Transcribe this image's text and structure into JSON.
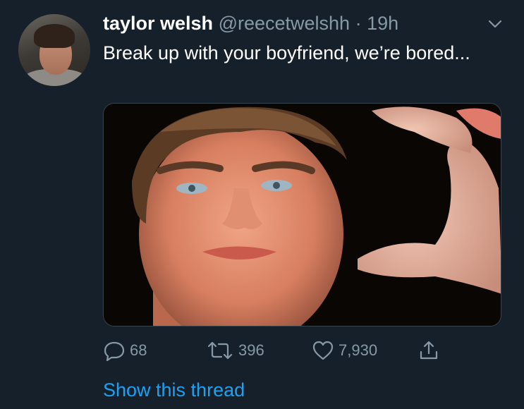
{
  "tweet": {
    "author_name": "taylor welsh",
    "handle": "@reecetwelshh",
    "separator": "·",
    "time": "19h",
    "text": "Break up with your boyfriend, we’re bored...",
    "avatar_icon": "profile-photo",
    "media_icon": "photo",
    "menu_icon": "chevron-down-icon"
  },
  "actions": {
    "reply_count": "68",
    "retweet_count": "396",
    "like_count": "7,930",
    "share_icon": "share-icon"
  },
  "thread": {
    "show_thread_label": "Show this thread"
  },
  "colors": {
    "background": "#15202b",
    "primary_text": "#ffffff",
    "secondary_text": "#8899a6",
    "link": "#1da1f2",
    "border": "#38444d"
  }
}
